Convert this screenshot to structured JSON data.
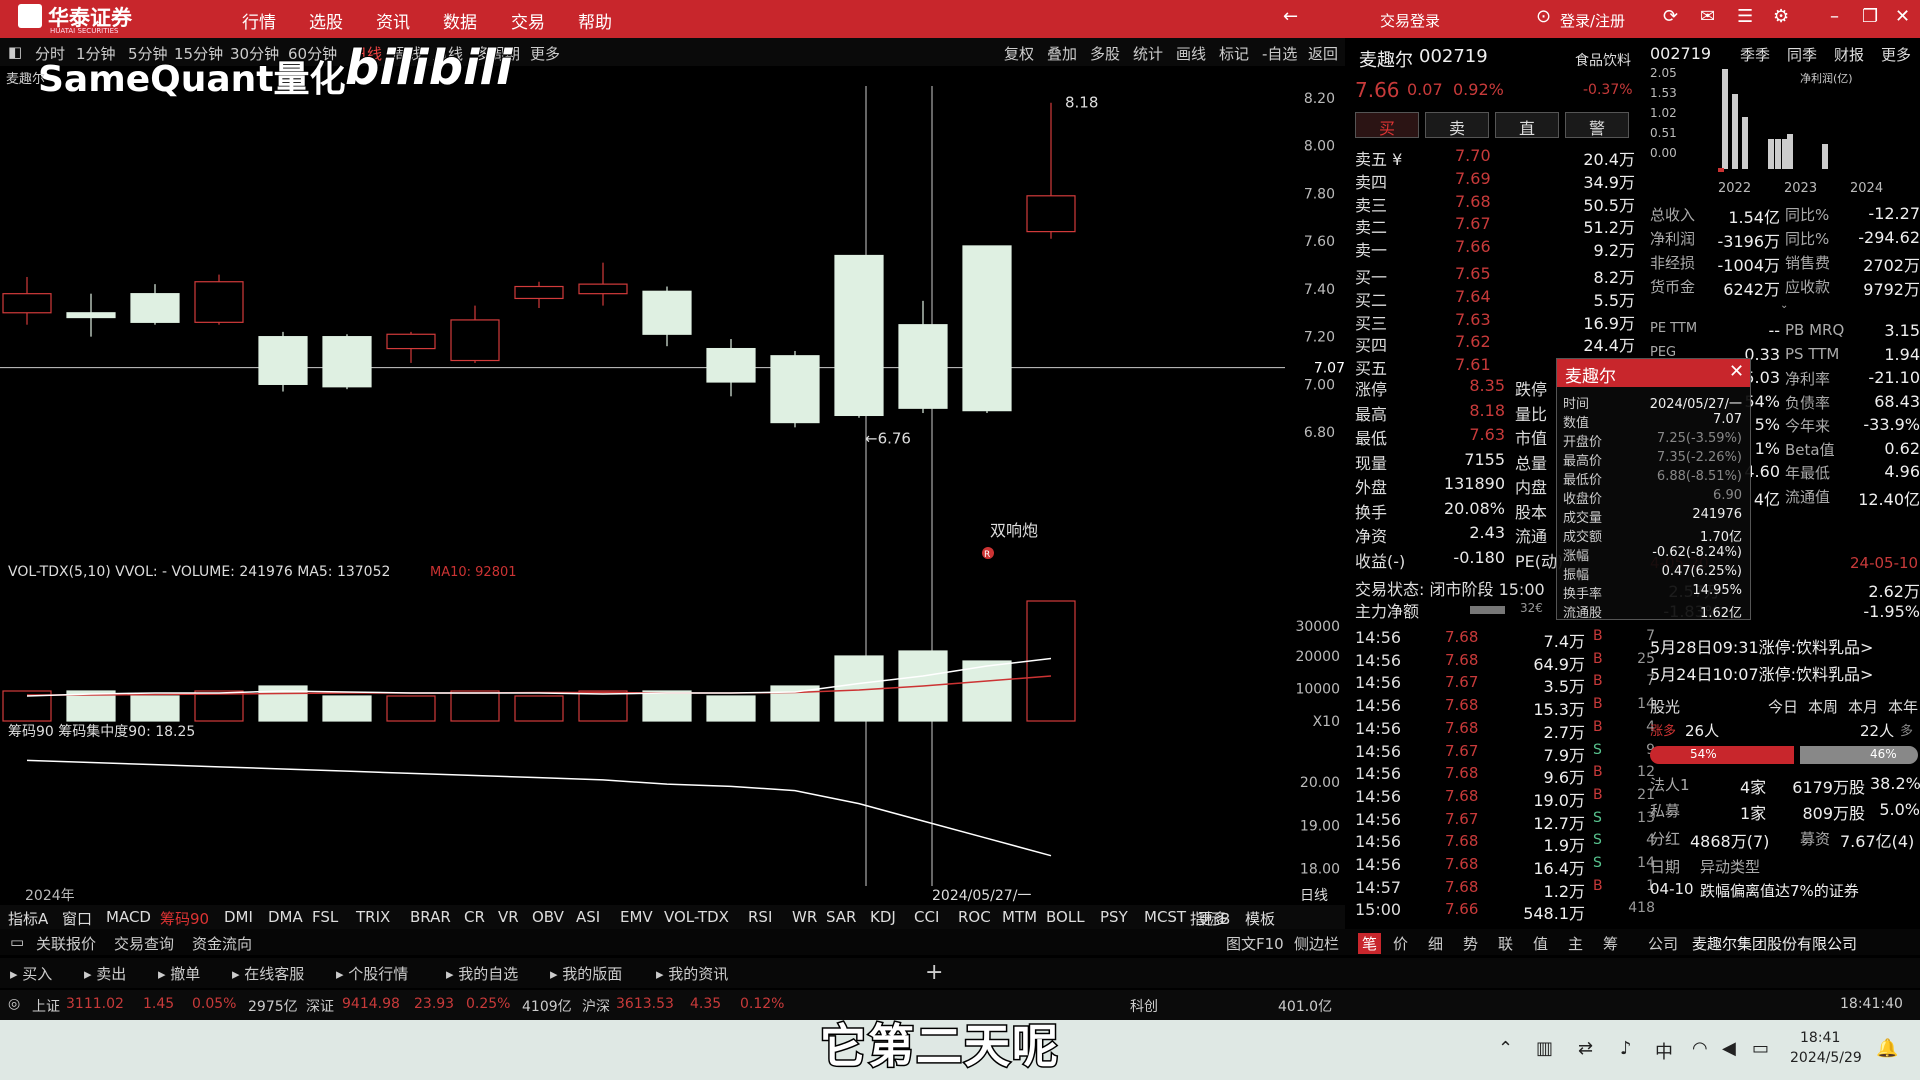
{
  "app": {
    "logo_text": "华泰证券",
    "logo_en": "HUATAI SECURITIES",
    "menu": [
      "行情",
      "选股",
      "资讯",
      "数据",
      "交易",
      "帮助"
    ],
    "trade_login": "交易登录",
    "user_login": "登录/注册"
  },
  "periods": [
    "分时",
    "1分钟",
    "5分钟",
    "15分钟",
    "30分钟",
    "60分钟",
    "日线",
    "周线",
    "月线",
    "多周期",
    "更多"
  ],
  "chart_toolbar": [
    "复权",
    "叠加",
    "多股",
    "统计",
    "画线",
    "标记",
    "-自选",
    "返回"
  ],
  "watermark": {
    "brand": "SameQuant量化",
    "site": "bilibili"
  },
  "stock_label": "麦趣尔",
  "price_axis": [
    "8.20",
    "8.00",
    "7.80",
    "7.60",
    "7.40",
    "7.20",
    "7.00",
    "6.80"
  ],
  "crosshair_price": "7.07",
  "annotations": {
    "high": "8.18",
    "low": "6.76",
    "pattern": "双响炮",
    "pattern_mark": "R"
  },
  "volume_header": "VOL-TDX(5,10)  VVOL: -  VOLUME: 241976  MA5: 137052",
  "volume_ma10": "MA10: 92801",
  "volume_axis": [
    "30000",
    "20000",
    "10000",
    "X10"
  ],
  "chip_header": "筹码90  筹码集中度90: 18.25",
  "chip_axis": [
    "20.00",
    "19.00",
    "18.00"
  ],
  "year_label": "2024年",
  "date_label": "2024/05/27/一",
  "period_tag": "日线",
  "indicators": [
    "指标A",
    "窗口",
    "MACD",
    "筹码90",
    "DMI",
    "DMA",
    "FSL",
    "TRIX",
    "BRAR",
    "CR",
    "VR",
    "OBV",
    "ASI",
    "EMV",
    "VOL-TDX",
    "RSI",
    "WR",
    "SAR",
    "KDJ",
    "CCI",
    "ROC",
    "MTM",
    "BOLL",
    "PSY",
    "MCST",
    "更多"
  ],
  "indicators_right": [
    "指标B",
    "模板"
  ],
  "bottom_links": [
    "关联报价",
    "交易查询",
    "资金流向"
  ],
  "action_bar": [
    "买入",
    "卖出",
    "撤单",
    "在线客服",
    "个股行情",
    "我的自选",
    "我的版面",
    "我的资讯"
  ],
  "right_tabs_mid": [
    "图文F10",
    "侧边栏"
  ],
  "right_tabs": [
    "笔",
    "价",
    "细",
    "势",
    "联",
    "值",
    "主",
    "筹"
  ],
  "company": {
    "label": "公司",
    "name": "麦趣尔集团股份有限公司"
  },
  "quote": {
    "name": "麦趣尔",
    "code": "002719",
    "sector": "食品饮料",
    "sector_pct": "-0.37%",
    "price": "7.66",
    "change": "0.07",
    "pct": "0.92%",
    "buttons": [
      "买",
      "卖",
      "直",
      "警"
    ],
    "sells": [
      {
        "label": "卖五 ¥",
        "price": "7.70",
        "vol": "20.4万"
      },
      {
        "label": "卖四",
        "price": "7.69",
        "vol": "34.9万"
      },
      {
        "label": "卖三",
        "price": "7.68",
        "vol": "50.5万"
      },
      {
        "label": "卖二",
        "price": "7.67",
        "vol": "51.2万"
      },
      {
        "label": "卖一",
        "price": "7.66",
        "vol": "9.2万"
      }
    ],
    "buys": [
      {
        "label": "买一",
        "price": "7.65",
        "vol": "8.2万"
      },
      {
        "label": "买二",
        "price": "7.64",
        "vol": "5.5万"
      },
      {
        "label": "买三",
        "price": "7.63",
        "vol": "16.9万"
      },
      {
        "label": "买四",
        "price": "7.62",
        "vol": "24.4万"
      },
      {
        "label": "买五",
        "price": "7.61",
        "vol": "2.2万"
      }
    ],
    "stats": [
      {
        "k": "涨停",
        "v": "8.35",
        "k2": "跌停"
      },
      {
        "k": "最高",
        "v": "8.18",
        "k2": "量比"
      },
      {
        "k": "最低",
        "v": "7.63",
        "k2": "市值"
      },
      {
        "k": "现量",
        "v": "7155",
        "k2": "总量"
      },
      {
        "k": "外盘",
        "v": "131890",
        "k2": "内盘"
      },
      {
        "k": "换手",
        "v": "20.08%",
        "k2": "股本"
      },
      {
        "k": "净资",
        "v": "2.43",
        "k2": "流通"
      },
      {
        "k": "收益(-)",
        "v": "-0.180",
        "k2": "PE(动)"
      }
    ],
    "trade_status": "交易状态: 闭市阶段 15:00",
    "main_net": "主力净额",
    "main_net_val": "32€"
  },
  "ticks": [
    {
      "t": "14:56",
      "p": "7.68",
      "v": "7.4万",
      "bs": "B",
      "n": "7"
    },
    {
      "t": "14:56",
      "p": "7.68",
      "v": "64.9万",
      "bs": "B",
      "n": "25"
    },
    {
      "t": "14:56",
      "p": "7.67",
      "v": "3.5万",
      "bs": "B",
      "n": "7"
    },
    {
      "t": "14:56",
      "p": "7.68",
      "v": "15.3万",
      "bs": "B",
      "n": "14"
    },
    {
      "t": "14:56",
      "p": "7.68",
      "v": "2.7万",
      "bs": "B",
      "n": "4"
    },
    {
      "t": "14:56",
      "p": "7.67",
      "v": "7.9万",
      "bs": "S",
      "n": "9"
    },
    {
      "t": "14:56",
      "p": "7.68",
      "v": "9.6万",
      "bs": "B",
      "n": "12"
    },
    {
      "t": "14:56",
      "p": "7.68",
      "v": "19.0万",
      "bs": "B",
      "n": "21"
    },
    {
      "t": "14:56",
      "p": "7.67",
      "v": "12.7万",
      "bs": "S",
      "n": "13"
    },
    {
      "t": "14:56",
      "p": "7.68",
      "v": "1.9万",
      "bs": "S",
      "n": "4"
    },
    {
      "t": "14:56",
      "p": "7.68",
      "v": "16.4万",
      "bs": "S",
      "n": "14"
    },
    {
      "t": "14:57",
      "p": "7.68",
      "v": "1.2万",
      "bs": "B",
      "n": "1"
    },
    {
      "t": "15:00",
      "p": "7.66",
      "v": "548.1万",
      "bs": "",
      "n": "418"
    }
  ],
  "fin": {
    "code": "002719",
    "tabs": [
      "季季",
      "同季",
      "财报",
      "更多"
    ],
    "sub": "净利润(亿)",
    "axis": [
      "2.05",
      "1.53",
      "1.02",
      "0.51",
      "0.00"
    ],
    "years": [
      "2022",
      "2023",
      "2024"
    ],
    "rows": [
      [
        "总收入",
        "1.54亿",
        "同比%",
        "-12.27"
      ],
      [
        "净利润",
        "-3196万",
        "同比%",
        "-294.62"
      ],
      [
        "非经损",
        "-1004万",
        "销售费",
        "2702万"
      ],
      [
        "货币金",
        "6242万",
        "应收款",
        "9792万"
      ]
    ],
    "rows2": [
      [
        "PE TTM",
        "--",
        "PB MRQ",
        "3.15"
      ],
      [
        "PEG",
        "0.33",
        "PS TTM",
        "1.94"
      ],
      [
        "",
        "5.03",
        "净利率",
        "-21.10"
      ],
      [
        "",
        "54%",
        "负债率",
        "68.43"
      ],
      [
        "",
        "5%",
        "今年来",
        "-33.9%"
      ],
      [
        "",
        "1%",
        "Beta值",
        "0.62"
      ],
      [
        "",
        "4.60",
        "年最低",
        "4.96"
      ],
      [
        "",
        "4亿",
        "流通值",
        "12.40亿"
      ]
    ],
    "dates": [
      "4-05-20",
      "24-05-10"
    ],
    "vals": [
      "2.57万",
      "2.62万"
    ],
    "pcts": [
      "-1.83%",
      "-1.95%"
    ],
    "news": [
      "5月28日09:31涨停:饮料乳品>",
      "5月24日10:07涨停:饮料乳品>"
    ],
    "sentiment_label": "股光",
    "periods": [
      "今日",
      "本周",
      "本月",
      "本年"
    ],
    "up_label": "涨多",
    "up_count": "26人",
    "down_count": "22人",
    "down_label": "多",
    "bull_pct": "54%",
    "bear_pct": "46%",
    "holders": [
      [
        "法人1",
        "4家",
        "6179万股",
        "38.2%"
      ],
      [
        "私募",
        "1家",
        "809万股",
        "5.0%"
      ]
    ],
    "dividend": [
      "分红",
      "4868万(7)",
      "募资",
      "7.67亿(4)"
    ],
    "event_hdr": [
      "日期",
      "异动类型"
    ],
    "event": [
      "04-10",
      "跌幅偏离值达7%的证券"
    ]
  },
  "popup": {
    "title": "麦趣尔",
    "rows": [
      [
        "时间",
        "2024/05/27/一"
      ],
      [
        "数值",
        "7.07"
      ],
      [
        "开盘价",
        "7.25(-3.59%)"
      ],
      [
        "最高价",
        "7.35(-2.26%)"
      ],
      [
        "最低价",
        "6.88(-8.51%)"
      ],
      [
        "收盘价",
        "6.90"
      ],
      [
        "成交量",
        "241976"
      ],
      [
        "成交额",
        "1.70亿"
      ],
      [
        "涨幅",
        "-0.62(-8.24%)"
      ],
      [
        "振幅",
        "0.47(6.25%)"
      ],
      [
        "换手率",
        "14.95%"
      ],
      [
        "流通股",
        "1.62亿"
      ]
    ]
  },
  "status": {
    "sh": "上证",
    "sh_val": "3111.02",
    "sh_chg": "1.45",
    "sh_pct": "0.05%",
    "sh_amt": "2975亿",
    "sz": "深证",
    "sz_val": "9414.98",
    "sz_chg": "23.93",
    "sz_pct": "0.25%",
    "sz_amt": "4109亿",
    "hs": "沪深",
    "hs_val": "3613.53",
    "hs_chg": "4.35",
    "hs_pct": "0.12%",
    "kc": "科创",
    "kc_amt": "401.0亿",
    "time": "18:41:40"
  },
  "taskbar": {
    "time": "18:41",
    "date": "2024/5/29",
    "ime": "中"
  },
  "subtitle": "它第二天呢",
  "chart_data": {
    "type": "candlestick",
    "ylim": [
      6.7,
      8.25
    ],
    "candles": [
      {
        "o": 7.3,
        "c": 7.38,
        "h": 7.45,
        "l": 7.25
      },
      {
        "o": 7.3,
        "c": 7.28,
        "h": 7.38,
        "l": 7.2
      },
      {
        "o": 7.38,
        "c": 7.26,
        "h": 7.42,
        "l": 7.25
      },
      {
        "o": 7.26,
        "c": 7.43,
        "h": 7.46,
        "l": 7.25
      },
      {
        "o": 7.2,
        "c": 7.0,
        "h": 7.22,
        "l": 6.97
      },
      {
        "o": 7.2,
        "c": 6.99,
        "h": 7.21,
        "l": 6.98
      },
      {
        "o": 7.15,
        "c": 7.21,
        "h": 7.22,
        "l": 7.09
      },
      {
        "o": 7.1,
        "c": 7.27,
        "h": 7.33,
        "l": 7.09
      },
      {
        "o": 7.36,
        "c": 7.41,
        "h": 7.43,
        "l": 7.32
      },
      {
        "o": 7.38,
        "c": 7.42,
        "h": 7.51,
        "l": 7.33
      },
      {
        "o": 7.39,
        "c": 7.21,
        "h": 7.41,
        "l": 7.16
      },
      {
        "o": 7.15,
        "c": 7.01,
        "h": 7.19,
        "l": 6.95
      },
      {
        "o": 7.12,
        "c": 6.84,
        "h": 7.14,
        "l": 6.82
      },
      {
        "o": 7.54,
        "c": 6.87,
        "h": 7.54,
        "l": 6.86
      },
      {
        "o": 7.25,
        "c": 6.9,
        "h": 7.35,
        "l": 6.88
      },
      {
        "o": 7.58,
        "c": 6.89,
        "h": 7.58,
        "l": 6.88
      },
      {
        "o": 7.64,
        "c": 7.79,
        "h": 8.18,
        "l": 7.61
      }
    ],
    "volume": [
      6,
      6,
      5,
      6,
      7,
      5,
      5,
      6,
      5,
      6,
      6,
      5,
      7,
      13,
      14,
      12,
      24
    ],
    "vol_ma5": [
      5,
      5.4,
      5.6,
      5.6,
      6,
      5.8,
      5.6,
      5.6,
      5.6,
      5.4,
      5.6,
      5.6,
      5.8,
      7.5,
      9,
      11,
      12.5
    ],
    "vol_ma10": [
      5.2,
      5.2,
      5.3,
      5.4,
      5.5,
      5.6,
      5.6,
      5.6,
      5.7,
      5.7,
      5.6,
      5.6,
      5.7,
      6.2,
      7,
      8,
      9
    ],
    "chip": [
      20.5,
      20.45,
      20.4,
      20.35,
      20.3,
      20.25,
      20.2,
      20.15,
      20.1,
      20.05,
      19.95,
      19.9,
      19.8,
      19.5,
      19.1,
      18.7,
      18.3
    ]
  }
}
